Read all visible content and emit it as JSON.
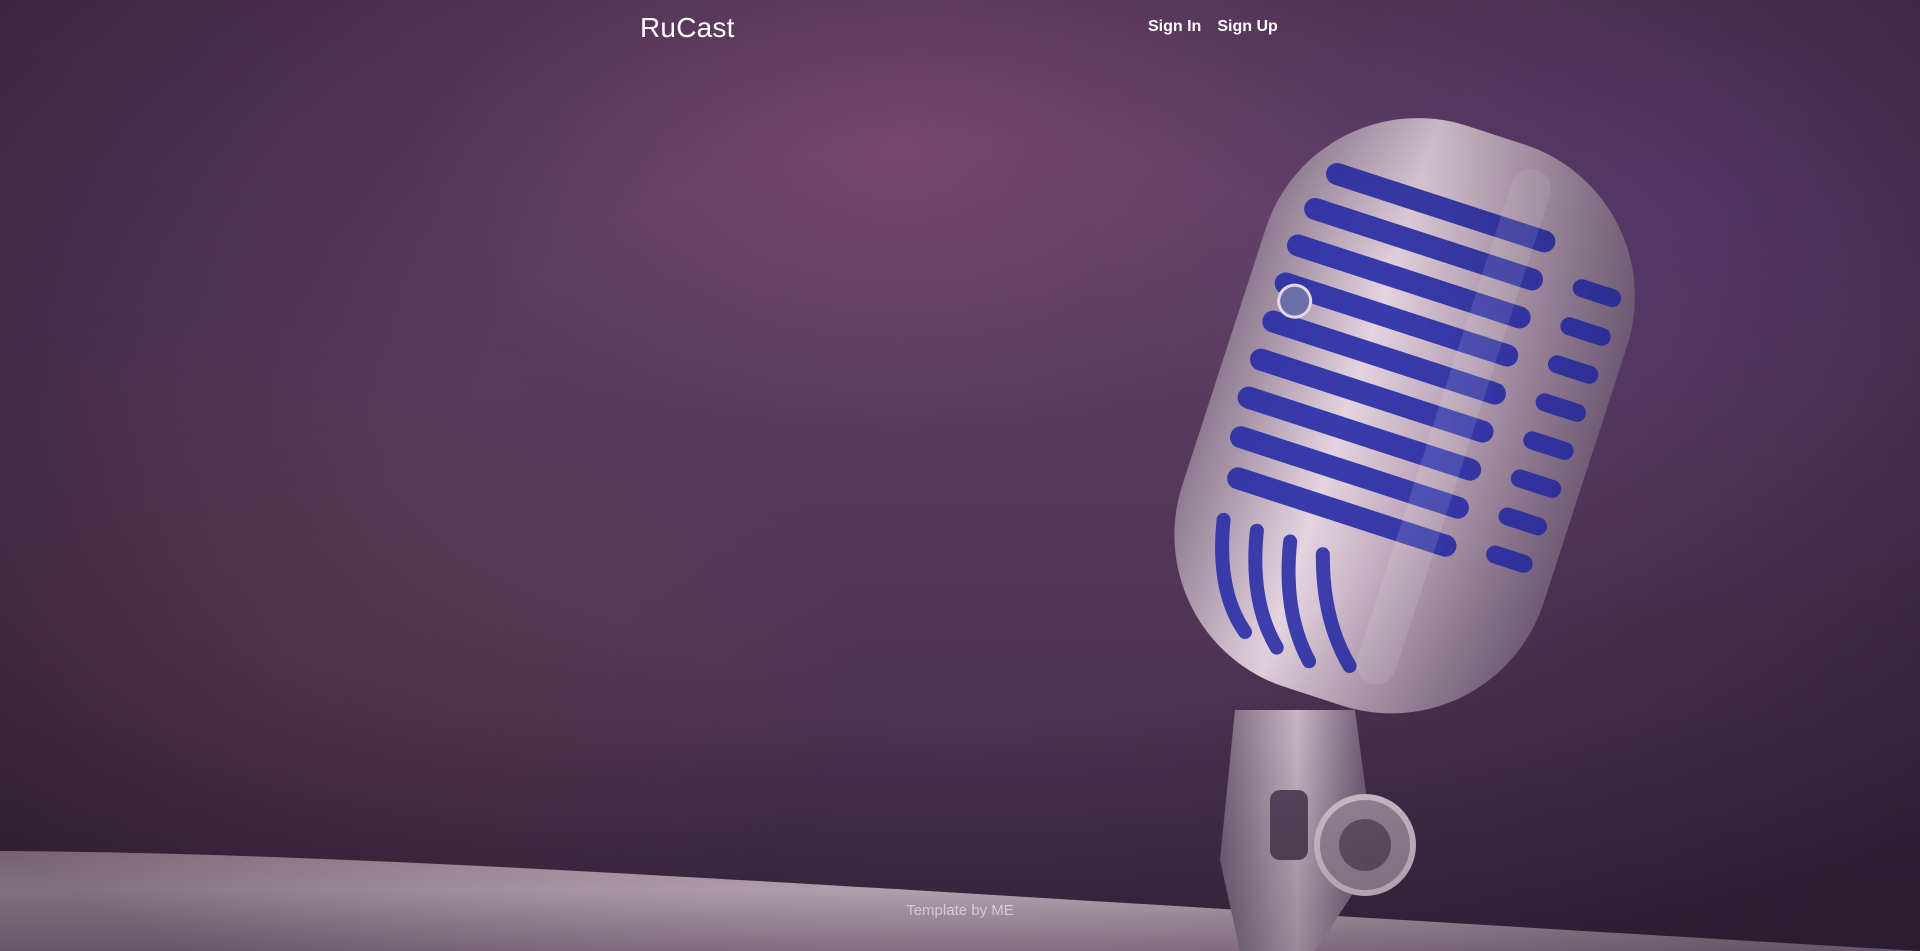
{
  "header": {
    "brand": "RuCast",
    "nav": [
      {
        "label": "Sign In"
      },
      {
        "label": "Sign Up"
      }
    ]
  },
  "footer": {
    "credit": "Template by ME"
  },
  "hero": {
    "image": "microphone-photo"
  },
  "colors": {
    "background": "#573a5d",
    "text": "#ffffff",
    "grille_blue": "#2b2fa8",
    "chrome": "#c9b7c7"
  }
}
